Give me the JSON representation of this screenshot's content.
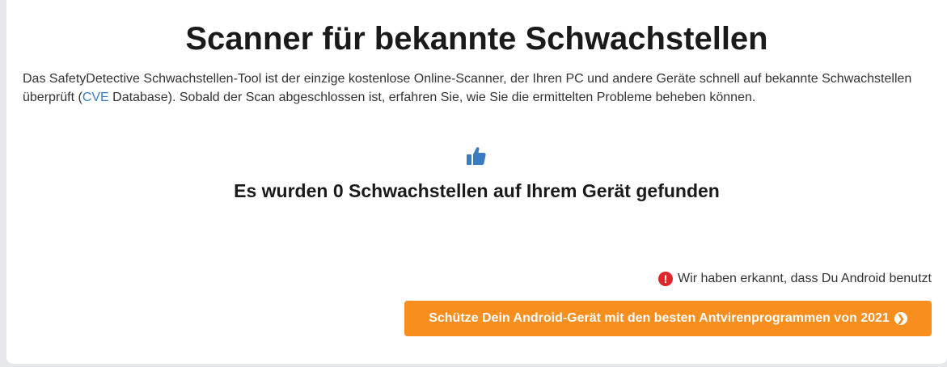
{
  "header": {
    "title": "Scanner für bekannte Schwachstellen"
  },
  "intro": {
    "text_before_link": "Das SafetyDetective Schwachstellen-Tool ist der einzige kostenlose Online-Scanner, der Ihren PC und andere Geräte schnell auf bekannte Schwachstellen überprüft (",
    "link_text": "CVE",
    "text_after_link": " Database). Sobald der Scan abgeschlossen ist, erfahren Sie, wie Sie die ermittelten Probleme beheben können."
  },
  "result": {
    "icon": "thumbs-up-icon",
    "text": "Es wurden 0 Schwachstellen auf Ihrem Gerät gefunden"
  },
  "detection": {
    "icon": "alert-icon",
    "icon_glyph": "!",
    "text": "Wir haben erkannt, dass Du Android benutzt"
  },
  "cta": {
    "label": "Schütze Dein Android-Gerät mit den besten Antvirenprogrammen von 2021",
    "icon": "chevron-circle-right-icon",
    "icon_glyph": "❯"
  },
  "colors": {
    "accent_orange": "#f78e1e",
    "link_blue": "#3b7bbf",
    "alert_red": "#e0262d",
    "icon_blue": "#3b7bbf"
  }
}
